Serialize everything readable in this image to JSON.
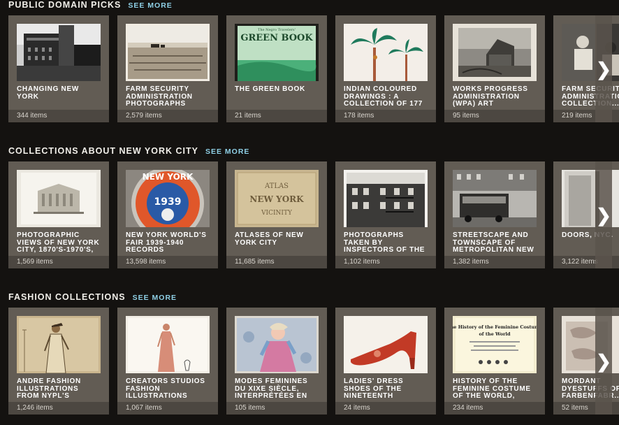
{
  "sections": [
    {
      "title": "PUBLIC DOMAIN PICKS",
      "see_more": "SEE MORE",
      "cards": [
        {
          "title": "CHANGING NEW YORK",
          "count": "344 items",
          "thumb": "building-photo"
        },
        {
          "title": "FARM SECURITY ADMINISTRATION PHOTOGRAPHS",
          "count": "2,579 items",
          "thumb": "field-photo"
        },
        {
          "title": "THE GREEN BOOK",
          "count": "21 items",
          "thumb": "green-book-cover"
        },
        {
          "title": "INDIAN COLOURED DRAWINGS : A COLLECTION OF 177",
          "count": "178 items",
          "thumb": "palm-trees-drawing"
        },
        {
          "title": "WORKS PROGRESS ADMINISTRATION (WPA) ART",
          "count": "95 items",
          "thumb": "house-print"
        },
        {
          "title": "FARM SECURITY ADMINISTRATION COLLECTION...",
          "count": "219 items",
          "thumb": "people-photo"
        }
      ]
    },
    {
      "title": "COLLECTIONS ABOUT NEW YORK CITY",
      "see_more": "SEE MORE",
      "cards": [
        {
          "title": "PHOTOGRAPHIC VIEWS OF NEW YORK CITY, 1870'S-1970'S,",
          "count": "1,569 items",
          "thumb": "building-drawing"
        },
        {
          "title": "NEW YORK WORLD'S FAIR 1939-1940 RECORDS",
          "count": "13,598 items",
          "thumb": "fair-button"
        },
        {
          "title": "ATLASES OF NEW YORK CITY",
          "count": "11,685 items",
          "thumb": "atlas-cover"
        },
        {
          "title": "PHOTOGRAPHS TAKEN BY INSPECTORS OF THE",
          "count": "1,102 items",
          "thumb": "tenement-photo"
        },
        {
          "title": "STREETSCAPE AND TOWNSCAPE OF METROPOLITAN NEW",
          "count": "1,382 items",
          "thumb": "street-photo"
        },
        {
          "title": "DOORS, NYC.",
          "count": "3,122 items",
          "thumb": "door-photo"
        }
      ]
    },
    {
      "title": "FASHION COLLECTIONS",
      "see_more": "SEE MORE",
      "cards": [
        {
          "title": "ANDRÉ FASHION ILLUSTRATIONS FROM NYPL'S",
          "count": "1,246 items",
          "thumb": "fashion-sketch"
        },
        {
          "title": "CREATORS STUDIOS FASHION ILLUSTRATIONS",
          "count": "1,067 items",
          "thumb": "dress-sketch"
        },
        {
          "title": "MODES FÉMININES DU XIXE SIÈCLE, INTERPRÉTÉES EN",
          "count": "105 items",
          "thumb": "fashion-plate"
        },
        {
          "title": "LADIES' DRESS SHOES OF THE NINETEENTH CENTURY",
          "count": "24 items",
          "thumb": "red-shoe"
        },
        {
          "title": "HISTORY OF THE FEMININE COSTUME OF THE WORLD,",
          "count": "234 items",
          "thumb": "costume-title-page"
        },
        {
          "title": "MORDANT DYESTUFFS OF FARBENFABR...",
          "count": "52 items",
          "thumb": "dyestuff-sample"
        }
      ]
    }
  ],
  "thumb_text": {
    "green_book_top": "The Negro Travelers'",
    "green_book_title": "GREEN BOOK",
    "fair_year": "1939",
    "fair_ny": "NEW YORK",
    "atlas_l1": "ATLAS",
    "atlas_l2": "NEW YORK",
    "atlas_l3": "VICINITY",
    "costume_l1": "The History of the Feminine Costume",
    "costume_l2": "of the World"
  },
  "icons": {
    "next": "chevron-right-icon"
  },
  "colors": {
    "background": "#141210",
    "card": "#625c54",
    "accent": "#8fd0e6"
  }
}
